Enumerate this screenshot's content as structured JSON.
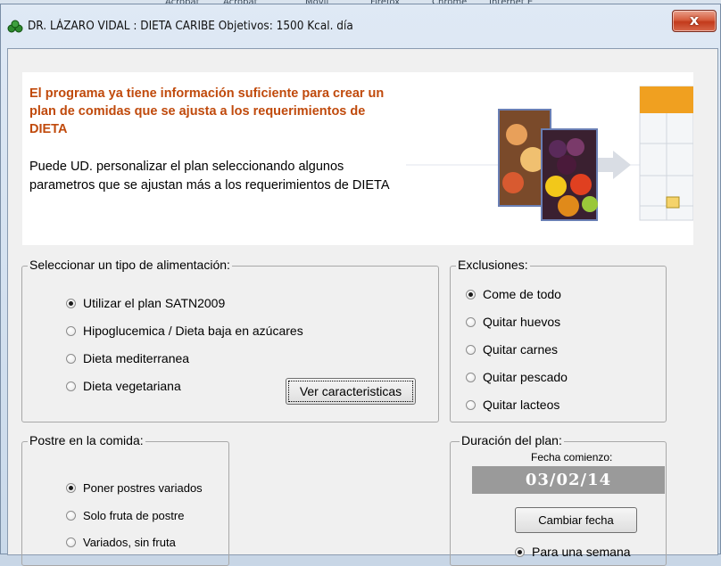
{
  "window": {
    "title": "DR. LÁZARO VIDAL : DIETA CARIBE  Objetivos: 1500 Kcal. día",
    "close_glyph": "x"
  },
  "background_taskbar_labels": [
    "Acrobat",
    "Acrobat",
    "Móvil",
    "Firefox",
    "Chrome",
    "Internet E"
  ],
  "banner": {
    "headline": "El programa ya tiene información suficiente para crear un plan de comidas que se ajusta a los requerimientos de DIETA",
    "body": "Puede UD. personalizar el plan seleccionando algunos parametros que se ajustan más a los requerimientos de DIETA"
  },
  "tipo": {
    "legend": "Seleccionar un tipo de alimentación:",
    "options": [
      {
        "label": "Utilizar el plan SATN2009",
        "checked": true
      },
      {
        "label": "Hipoglucemica / Dieta baja en azúcares",
        "checked": false
      },
      {
        "label": "Dieta mediterranea",
        "checked": false
      },
      {
        "label": "Dieta vegetariana",
        "checked": false
      }
    ],
    "button": "Ver caracteristicas"
  },
  "exclusiones": {
    "legend": "Exclusiones:",
    "options": [
      {
        "label": "Come de todo",
        "checked": true
      },
      {
        "label": "Quitar huevos",
        "checked": false
      },
      {
        "label": "Quitar carnes",
        "checked": false
      },
      {
        "label": "Quitar pescado",
        "checked": false
      },
      {
        "label": "Quitar lacteos",
        "checked": false
      }
    ]
  },
  "postre": {
    "legend": "Postre en la comida:",
    "options": [
      {
        "label": "Poner postres variados",
        "checked": true
      },
      {
        "label": "Solo fruta de postre",
        "checked": false
      },
      {
        "label": "Variados, sin fruta",
        "checked": false
      }
    ]
  },
  "duracion": {
    "legend": "Duración del plan:",
    "start_label": "Fecha comienzo:",
    "start_date": "03/02/14",
    "button": "Cambiar fecha",
    "options": [
      {
        "label": "Para una semana",
        "checked": true
      }
    ]
  }
}
